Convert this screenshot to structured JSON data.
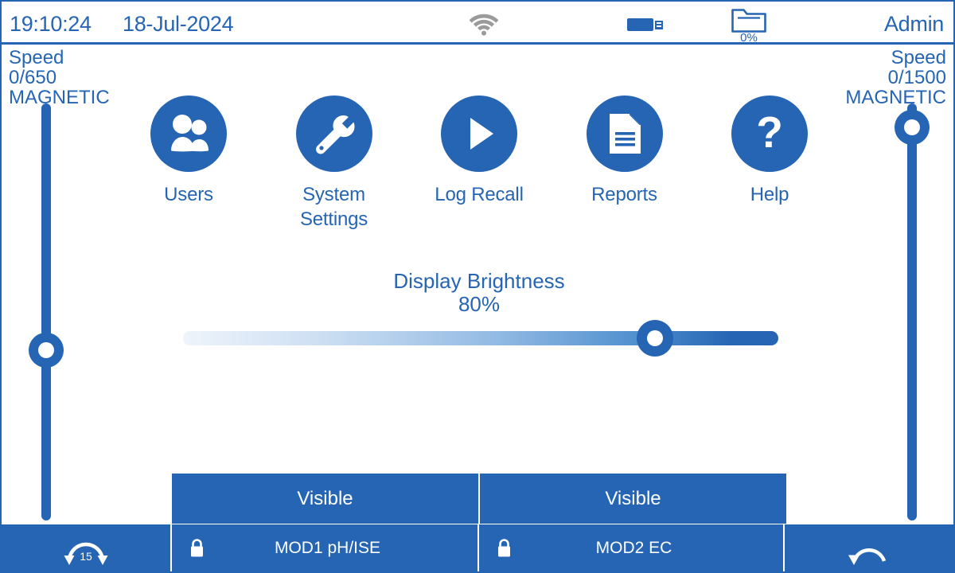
{
  "header": {
    "time": "19:10:24",
    "date": "18-Jul-2024",
    "user": "Admin",
    "wifi_icon": "wifi-icon",
    "usb_icon": "usb-drive-icon",
    "folder_icon": "folder-icon",
    "folder_percent": "0%"
  },
  "left_channel": {
    "title": "Speed",
    "value": "0/650",
    "mode": "MAGNETIC"
  },
  "right_channel": {
    "title": "Speed",
    "value": "0/1500",
    "mode": "MAGNETIC"
  },
  "menu": {
    "items": [
      {
        "label": "Users",
        "icon": "users-icon"
      },
      {
        "label": "System\nSettings",
        "label_line1": "System",
        "label_line2": "Settings",
        "icon": "wrench-icon"
      },
      {
        "label": "Log Recall",
        "icon": "play-icon"
      },
      {
        "label": "Reports",
        "icon": "document-icon"
      },
      {
        "label": "Help",
        "icon": "question-mark-icon"
      }
    ]
  },
  "brightness": {
    "title": "Display Brightness",
    "value": "80%",
    "percent": 80
  },
  "visible_buttons": [
    {
      "label": "Visible"
    },
    {
      "label": "Visible"
    }
  ],
  "bottom_bar": {
    "timeout_seconds": "15",
    "timeout_icon": "timeout-arc-icon",
    "modules": [
      {
        "label": "MOD1 pH/ISE",
        "lock_icon": "lock-icon"
      },
      {
        "label": "MOD2 EC",
        "lock_icon": "lock-icon"
      }
    ],
    "back_icon": "back-arrow-icon"
  },
  "colors": {
    "accent": "#2565b4",
    "wifi_inactive": "#9a9a9a",
    "background": "#ffffff"
  }
}
